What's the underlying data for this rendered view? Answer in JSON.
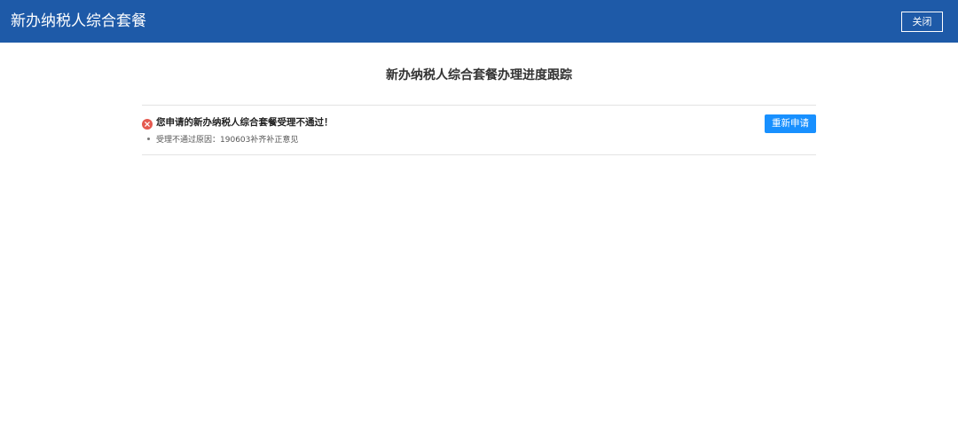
{
  "header": {
    "title": "新办纳税人综合套餐",
    "close_label": "关闭",
    "background_color": "#1e5aa8"
  },
  "main": {
    "page_title": "新办纳税人综合套餐办理进度跟踪",
    "status": {
      "icon": "error-circle-x-icon",
      "icon_color": "#e5594f",
      "message": "您申请的新办纳税人综合套餐受理不通过！"
    },
    "reason": {
      "label": "受理不通过原因：",
      "value": "190603补齐补正意见"
    },
    "reapply_label": "重新申请",
    "reapply_color": "#1890ff"
  }
}
